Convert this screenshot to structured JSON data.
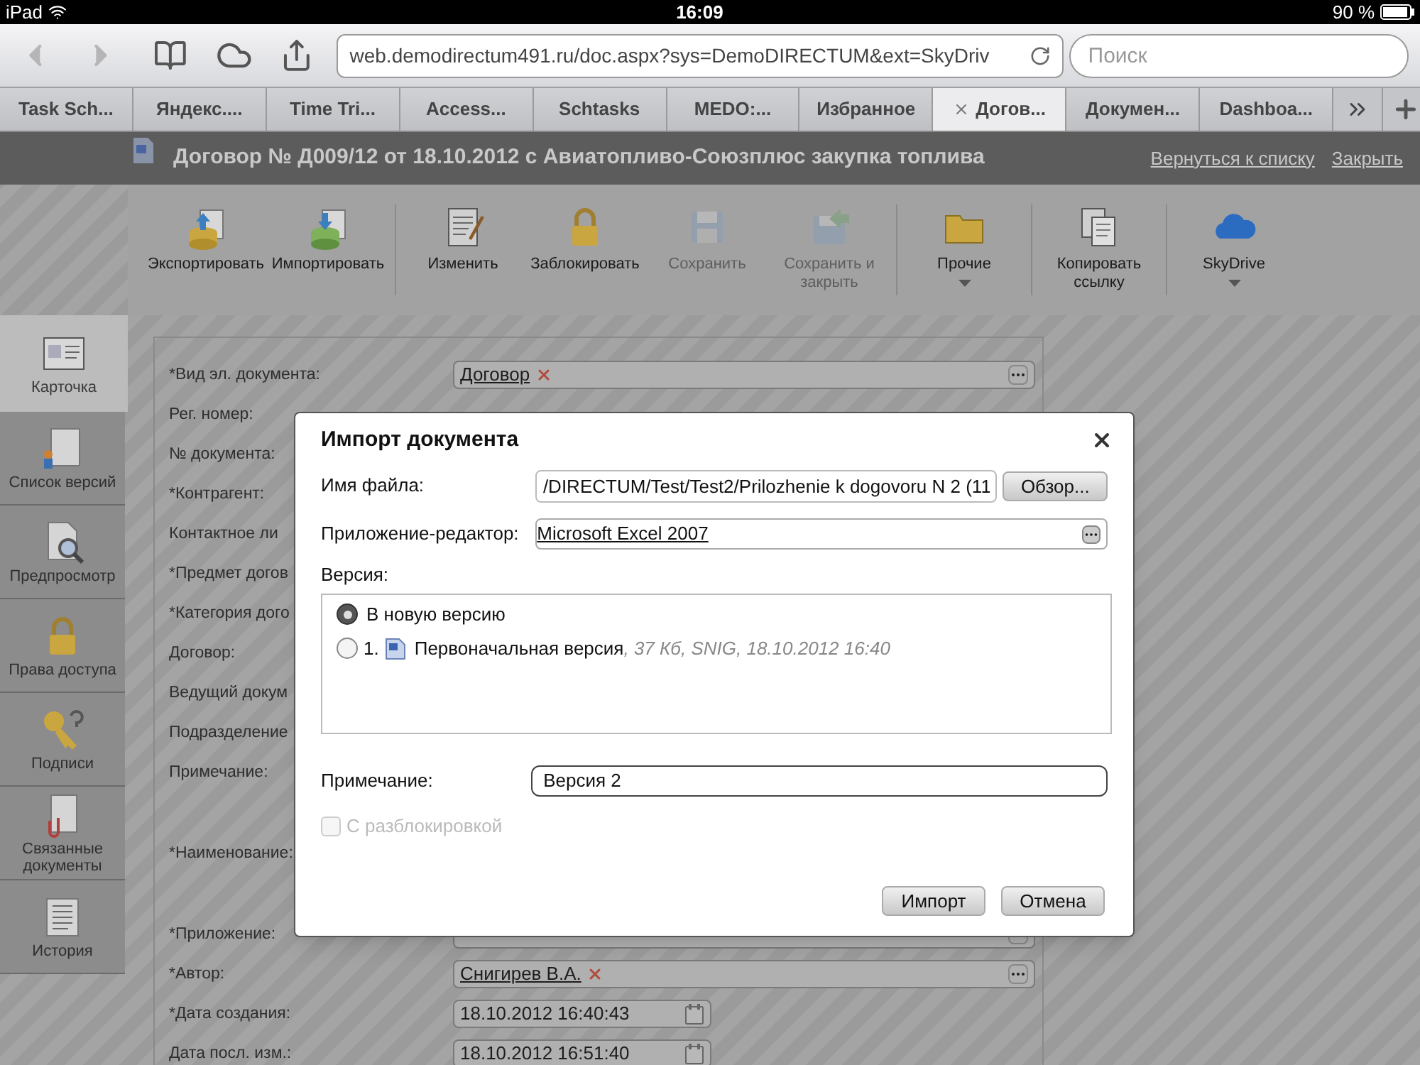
{
  "status_bar": {
    "device": "iPad",
    "time": "16:09",
    "battery": "90 %"
  },
  "browser": {
    "url": "web.demodirectum491.ru/doc.aspx?sys=DemoDIRECTUM&ext=SkyDriv",
    "search_placeholder": "Поиск",
    "tabs": [
      {
        "label": "Task Sch...",
        "selected": false
      },
      {
        "label": "Яндекс....",
        "selected": false
      },
      {
        "label": "Time Tri...",
        "selected": false
      },
      {
        "label": "Access...",
        "selected": false
      },
      {
        "label": "Schtasks",
        "selected": false
      },
      {
        "label": "MEDO:...",
        "selected": false
      },
      {
        "label": "Избранное",
        "selected": false
      },
      {
        "label": "Догов...",
        "selected": true
      },
      {
        "label": "Докумен...",
        "selected": false
      },
      {
        "label": "Dashboa...",
        "selected": false
      }
    ]
  },
  "header": {
    "title": "Договор № Д009/12 от 18.10.2012 с Авиатопливо-Союзплюс закупка топлива",
    "links": [
      "Вернуться к списку",
      "Закрыть"
    ]
  },
  "toolbar": {
    "groups": [
      [
        {
          "label": "Экспортировать",
          "disabled": false,
          "dropdown": false
        },
        {
          "label": "Импортировать",
          "disabled": false,
          "dropdown": false
        }
      ],
      [
        {
          "label": "Изменить",
          "disabled": false,
          "dropdown": false
        },
        {
          "label": "Заблокировать",
          "disabled": false,
          "dropdown": false
        },
        {
          "label": "Сохранить",
          "disabled": true,
          "dropdown": false
        },
        {
          "label": "Сохранить и закрыть",
          "disabled": true,
          "dropdown": false
        }
      ],
      [
        {
          "label": "Прочие",
          "disabled": false,
          "dropdown": true
        }
      ],
      [
        {
          "label": "Копировать ссылку",
          "disabled": false,
          "dropdown": false
        }
      ],
      [
        {
          "label": "SkyDrive",
          "disabled": false,
          "dropdown": true
        }
      ]
    ]
  },
  "sidebar": {
    "items": [
      {
        "label": "Карточка",
        "selected": true
      },
      {
        "label": "Список версий",
        "selected": false
      },
      {
        "label": "Предпросмотр",
        "selected": false
      },
      {
        "label": "Права доступа",
        "selected": false
      },
      {
        "label": "Подписи",
        "selected": false
      },
      {
        "label": "Связанные документы",
        "selected": false
      },
      {
        "label": "История",
        "selected": false
      }
    ]
  },
  "form": {
    "rows": [
      {
        "label": "*Вид эл. документа:",
        "kind": "single",
        "field": {
          "kind": "lookup",
          "value": "Договор"
        }
      },
      {
        "label": "Рег. номер:",
        "kind": "single"
      },
      {
        "label": "№ документа:",
        "kind": "single"
      },
      {
        "label": "*Контрагент:",
        "kind": "single"
      },
      {
        "label": "Контактное ли",
        "kind": "single"
      },
      {
        "label": "*Предмет догов",
        "kind": "single"
      },
      {
        "label": "*Категория дого",
        "kind": "single"
      },
      {
        "label": "Договор:",
        "kind": "single"
      },
      {
        "label": "Ведущий докум",
        "kind": "single"
      },
      {
        "label": "Подразделение",
        "kind": "single"
      },
      {
        "label": "Примечание:",
        "kind": "multiline"
      },
      {
        "label": "*Наименование:",
        "kind": "multiline"
      },
      {
        "label": "*Приложение:",
        "kind": "single",
        "field": {
          "kind": "lookup"
        }
      },
      {
        "label": "*Автор:",
        "kind": "single",
        "field": {
          "kind": "lookup",
          "value": "Снигирев В.А."
        }
      },
      {
        "label": "*Дата создания:",
        "kind": "single",
        "field": {
          "kind": "date",
          "value": "18.10.2012 16:40:43"
        }
      },
      {
        "label": "Дата посл. изм.:",
        "kind": "single",
        "field": {
          "kind": "date",
          "value": "18.10.2012 16:51:40"
        }
      }
    ]
  },
  "dialog": {
    "title": "Импорт документа",
    "file": {
      "label": "Имя файла:",
      "value": "/DIRECTUM/Test/Test2/Prilozhenie k dogovoru N 2 (11",
      "button": "Обзор..."
    },
    "editor": {
      "label": "Приложение-редактор:",
      "value": "Microsoft Excel 2007"
    },
    "version": {
      "label": "Версия:",
      "options": [
        {
          "label": "В новую версию",
          "selected": true
        },
        {
          "number": "1.",
          "label": "Первоначальная версия",
          "details": ", 37 Кб, SNIG, 18.10.2012 16:40",
          "selected": false
        }
      ]
    },
    "note": {
      "label": "Примечание:",
      "value": "Версия 2"
    },
    "unlock": {
      "label": "С разблокировкой",
      "checked": false,
      "disabled": true
    },
    "buttons": [
      "Импорт",
      "Отмена"
    ]
  }
}
